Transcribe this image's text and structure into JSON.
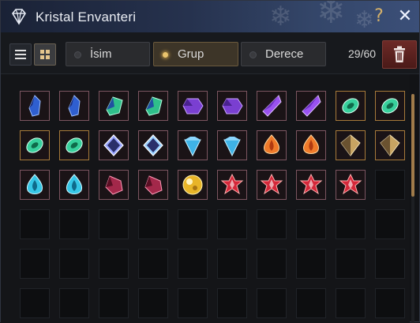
{
  "window": {
    "title": "Kristal Envanteri",
    "help_label": "?",
    "close_label": "✕"
  },
  "toolbar": {
    "sort_options": [
      {
        "label": "İsim",
        "selected": false
      },
      {
        "label": "Grup",
        "selected": true
      },
      {
        "label": "Derece",
        "selected": false
      }
    ],
    "view_mode": "grid",
    "count": "29/60"
  },
  "inventory": {
    "columns": 10,
    "capacity": 60,
    "slots": [
      {
        "icon": "blue-crystal-icon",
        "color": "#2f5fd0"
      },
      {
        "icon": "blue-crystal-icon",
        "color": "#2f5fd0"
      },
      {
        "icon": "green-blue-crystal-icon",
        "color": "#2fbf8a"
      },
      {
        "icon": "green-blue-crystal-icon",
        "color": "#2fbf8a"
      },
      {
        "icon": "purple-hex-crystal-icon",
        "color": "#7a3fd1"
      },
      {
        "icon": "purple-hex-crystal-icon",
        "color": "#7a3fd1"
      },
      {
        "icon": "violet-shard-crystal-icon",
        "color": "#9a52f0"
      },
      {
        "icon": "violet-shard-crystal-icon",
        "color": "#9a52f0"
      },
      {
        "icon": "green-oval-crystal-icon",
        "color": "#38d09c"
      },
      {
        "icon": "green-oval-crystal-icon",
        "color": "#38d09c"
      },
      {
        "icon": "green-oval-crystal-icon",
        "color": "#38d09c"
      },
      {
        "icon": "green-oval-crystal-icon",
        "color": "#38d09c"
      },
      {
        "icon": "white-prism-crystal-icon",
        "color": "#9aa6ff"
      },
      {
        "icon": "white-prism-crystal-icon",
        "color": "#9ad0ff"
      },
      {
        "icon": "cyan-diamond-crystal-icon",
        "color": "#3fb3e6"
      },
      {
        "icon": "cyan-diamond-crystal-icon",
        "color": "#3fb3e6"
      },
      {
        "icon": "orange-drop-crystal-icon",
        "color": "#ef7a2a"
      },
      {
        "icon": "orange-drop-crystal-icon",
        "color": "#ef7a2a"
      },
      {
        "icon": "gold-prism-crystal-icon",
        "color": "#c7a462"
      },
      {
        "icon": "gold-prism-crystal-icon",
        "color": "#c7a462"
      },
      {
        "icon": "cyan-drop-crystal-icon",
        "color": "#36c6e6"
      },
      {
        "icon": "cyan-drop-crystal-icon",
        "color": "#36c6e6"
      },
      {
        "icon": "crimson-crystal-icon",
        "color": "#a3284a"
      },
      {
        "icon": "crimson-crystal-icon",
        "color": "#a3284a"
      },
      {
        "icon": "gold-orb-crystal-icon",
        "color": "#e8b428"
      },
      {
        "icon": "red-star-crystal-icon",
        "color": "#d4283a"
      },
      {
        "icon": "red-star-crystal-icon",
        "color": "#d4283a"
      },
      {
        "icon": "red-star-crystal-icon",
        "color": "#d4283a"
      },
      {
        "icon": "red-star-crystal-icon",
        "color": "#d4283a"
      }
    ]
  }
}
